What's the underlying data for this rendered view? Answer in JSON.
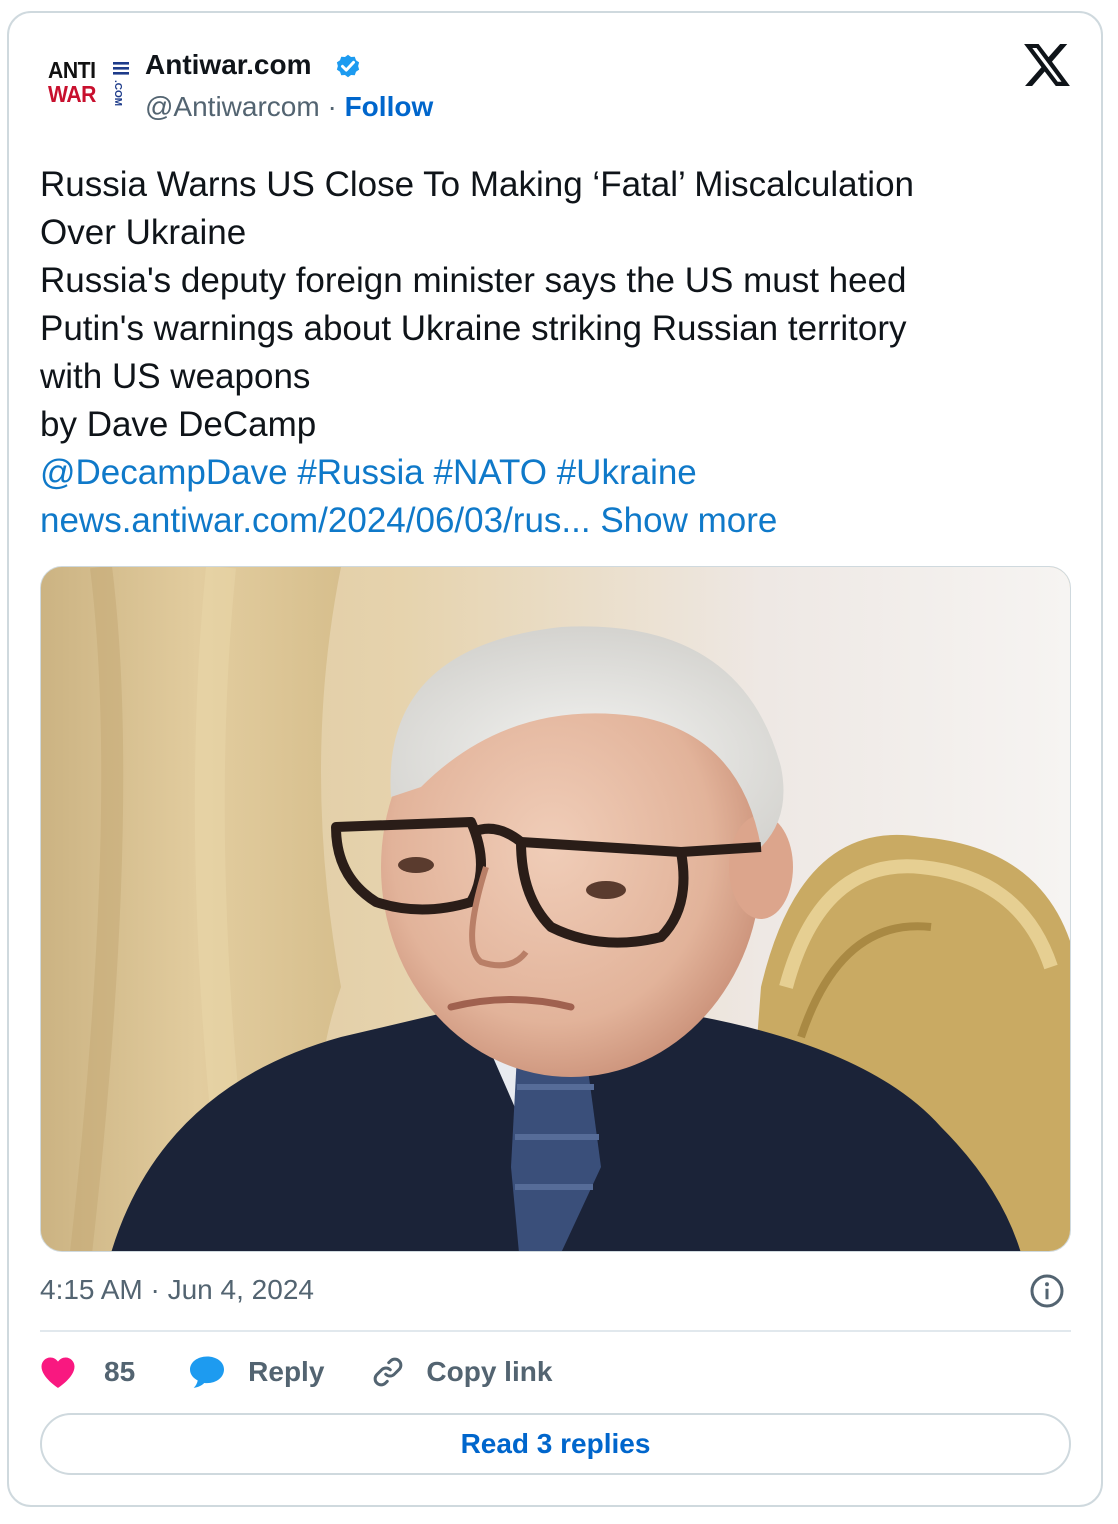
{
  "author": {
    "name": "Antiwar.com",
    "handle": "@Antiwarcom",
    "separator": "·",
    "follow_label": "Follow",
    "logo_text": [
      "ANTI",
      "WAR",
      ".COM"
    ]
  },
  "tweet": {
    "lines": [
      "Russia Warns US Close To Making ‘Fatal’ Miscalculation",
      "Over Ukraine",
      "Russia's deputy foreign minister says the US must heed",
      "Putin's warnings about Ukraine striking Russian territory",
      "with US weapons",
      "by Dave DeCamp"
    ],
    "mention": "@DecampDave",
    "hashtags": [
      "#Russia",
      "#NATO",
      "#Ukraine"
    ],
    "url": "news.antiwar.com/2024/06/03/rus...",
    "show_more": "Show more"
  },
  "media": {
    "icon": "photo"
  },
  "footer": {
    "timestamp": "4:15 AM · Jun 4, 2024",
    "likes": "85",
    "reply_label": "Reply",
    "copy_link_label": "Copy link",
    "read_replies_label": "Read 3 replies"
  },
  "colors": {
    "link": "#0f79c9",
    "follow": "#0066cc",
    "heart": "#f91880",
    "reply_bubble": "#1d9bf0",
    "verified": "#1d9bf0",
    "logo_red": "#c8102e",
    "border": "#cfd9de",
    "muted": "#536471"
  },
  "icons": [
    "verified-badge-icon",
    "x-logo-icon",
    "info-icon",
    "heart-icon",
    "reply-bubble-icon",
    "link-icon"
  ]
}
